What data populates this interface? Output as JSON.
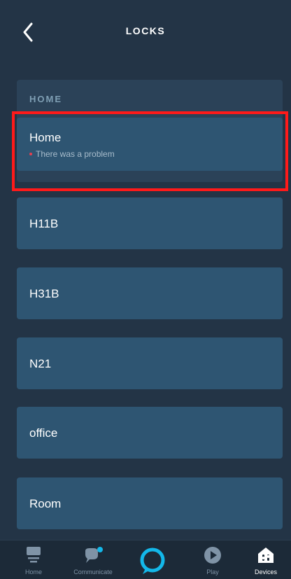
{
  "header": {
    "title": "LOCKS"
  },
  "group": {
    "label": "HOME"
  },
  "devices": [
    {
      "name": "Home",
      "status": "There was a problem"
    },
    {
      "name": "H11B"
    },
    {
      "name": "H31B"
    },
    {
      "name": "N21"
    },
    {
      "name": "office"
    },
    {
      "name": "Room"
    }
  ],
  "nav": {
    "home": "Home",
    "communicate": "Communicate",
    "play": "Play",
    "devices": "Devices"
  },
  "colors": {
    "background": "#233446",
    "card": "#2e5572",
    "status_dot": "#e5404f",
    "alexa_ring": "#13b8ea",
    "highlight": "#ff1a1a"
  },
  "icons": {
    "back": "chevron-left-icon",
    "nav_home": "home-icon",
    "nav_communicate": "chat-bubble-icon",
    "nav_alexa": "alexa-ring-icon",
    "nav_play": "play-icon",
    "nav_devices": "devices-icon"
  }
}
